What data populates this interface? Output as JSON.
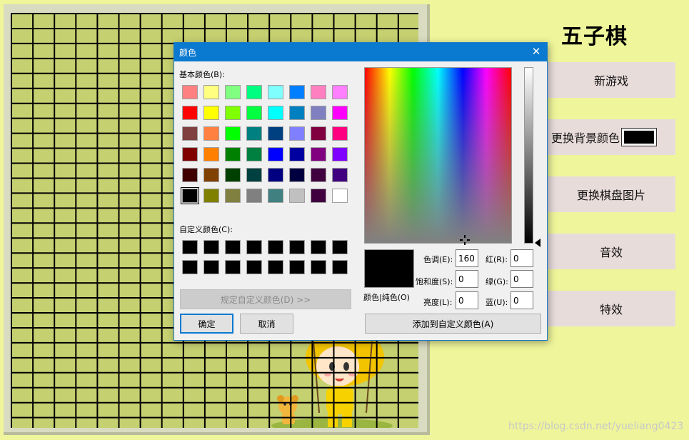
{
  "app": {
    "title": "五子棋",
    "buttons": {
      "new_game": "新游戏",
      "change_bg_color": "更换背景颜色",
      "change_board_image": "更换棋盘图片",
      "sound": "音效",
      "effects": "特效"
    },
    "bg_swatch_color": "#000000",
    "board_color": "#c5d070",
    "page_bg": "#eef59a"
  },
  "dialog": {
    "title": "颜色",
    "basic_colors_label": "基本颜色(B):",
    "custom_colors_label": "自定义颜色(C):",
    "define_custom_button": "规定自定义颜色(D) >>",
    "ok_button": "确定",
    "cancel_button": "取消",
    "add_custom_button": "添加到自定义颜色(A)",
    "color_solid_label": "颜色|纯色(O)",
    "hue_label": "色调(E):",
    "sat_label": "饱和度(S):",
    "lum_label": "亮度(L):",
    "red_label": "红(R):",
    "green_label": "绿(G):",
    "blue_label": "蓝(U):",
    "hue": "160",
    "sat": "0",
    "lum": "0",
    "red": "0",
    "green": "0",
    "blue": "0",
    "selected_basic_index": 40,
    "basic_colors": [
      "#ff8080",
      "#ffff80",
      "#80ff80",
      "#00ff80",
      "#80ffff",
      "#0080ff",
      "#ff80c0",
      "#ff80ff",
      "#ff0000",
      "#ffff00",
      "#80ff00",
      "#00ff40",
      "#00ffff",
      "#0080c0",
      "#8080c0",
      "#ff00ff",
      "#804040",
      "#ff8040",
      "#00ff00",
      "#008080",
      "#004080",
      "#8080ff",
      "#800040",
      "#ff0080",
      "#800000",
      "#ff8000",
      "#008000",
      "#008040",
      "#0000ff",
      "#0000a0",
      "#800080",
      "#8000ff",
      "#400000",
      "#804000",
      "#004000",
      "#004040",
      "#000080",
      "#000040",
      "#400040",
      "#400080",
      "#000000",
      "#808000",
      "#808040",
      "#808080",
      "#408080",
      "#c0c0c0",
      "#400040",
      "#ffffff"
    ],
    "custom_colors": [
      "#000000",
      "#000000",
      "#000000",
      "#000000",
      "#000000",
      "#000000",
      "#000000",
      "#000000",
      "#000000",
      "#000000",
      "#000000",
      "#000000",
      "#000000",
      "#000000",
      "#000000",
      "#000000"
    ]
  },
  "watermark": "https://blog.csdn.net/yueliang0423"
}
